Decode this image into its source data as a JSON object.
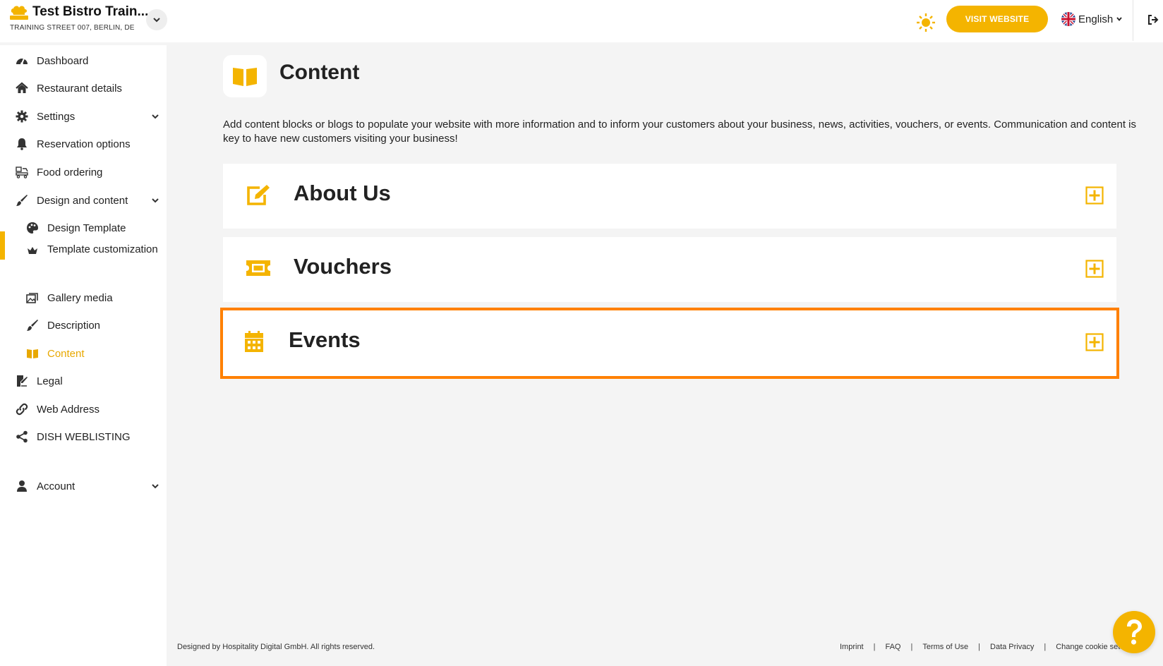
{
  "brand": {
    "name": "Test Bistro Train...",
    "address": "TRAINING STREET 007, BERLIN, DE"
  },
  "header": {
    "visit_label": "VISIT WEBSITE",
    "language": "English"
  },
  "sidebar": {
    "items": [
      {
        "label": "Dashboard"
      },
      {
        "label": "Restaurant details"
      },
      {
        "label": "Settings"
      },
      {
        "label": "Reservation options"
      },
      {
        "label": "Food ordering"
      },
      {
        "label": "Design and content"
      },
      {
        "label": "Design Template"
      },
      {
        "label": "Template customization"
      },
      {
        "label": "Gallery media"
      },
      {
        "label": "Description"
      },
      {
        "label": "Content"
      },
      {
        "label": "Legal"
      },
      {
        "label": "Web Address"
      },
      {
        "label": "DISH WEBLISTING"
      },
      {
        "label": "Account"
      }
    ]
  },
  "main": {
    "title": "Content",
    "description": "Add content blocks or blogs to populate your website with more information and to inform your customers about your business, news, activities, vouchers, or events. Communication and content is key to have new customers visiting your business!",
    "cards": [
      {
        "title": "About Us",
        "icon": "edit-icon"
      },
      {
        "title": "Vouchers",
        "icon": "ticket-icon"
      },
      {
        "title": "Events",
        "icon": "calendar-icon"
      }
    ]
  },
  "footer": {
    "copyright": "Designed by Hospitality Digital GmbH. All rights reserved.",
    "links": [
      "Imprint",
      "FAQ",
      "Terms of Use",
      "Data Privacy",
      "Change cookie settings"
    ]
  },
  "colors": {
    "accent": "#f4b400",
    "highlight": "#ff8000",
    "background": "#f4f4f4"
  }
}
